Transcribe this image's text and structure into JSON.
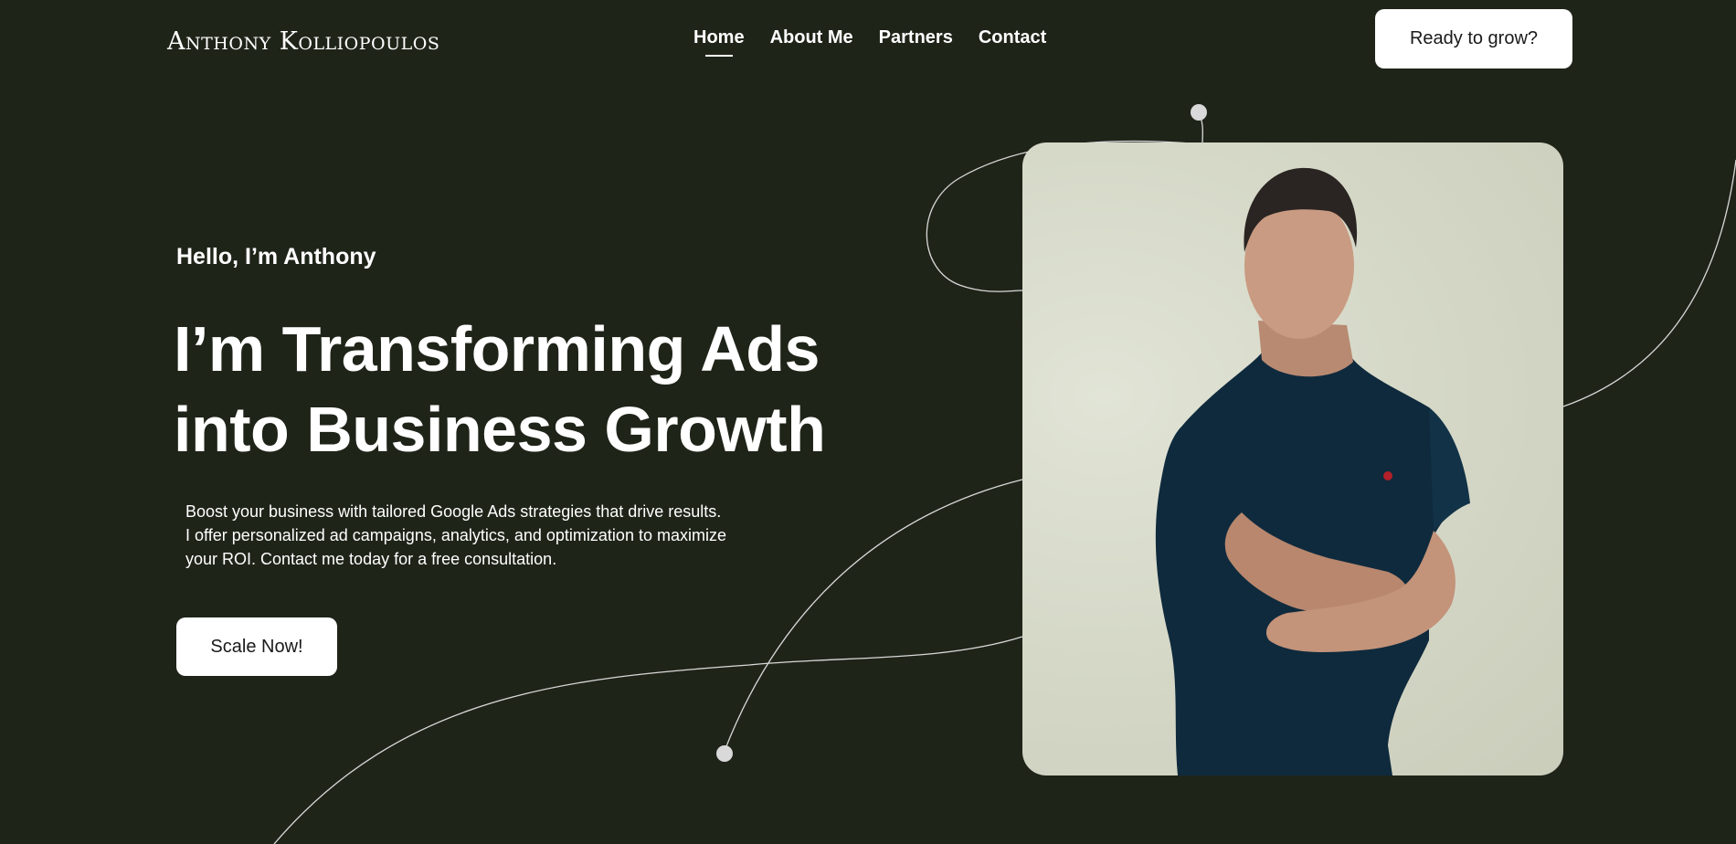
{
  "header": {
    "brand": "Anthony Kolliopoulos",
    "nav": [
      {
        "label": "Home",
        "active": true
      },
      {
        "label": "About Me",
        "active": false
      },
      {
        "label": "Partners",
        "active": false
      },
      {
        "label": "Contact",
        "active": false
      }
    ],
    "cta_label": "Ready to grow?"
  },
  "hero": {
    "greeting": "Hello, I’m Anthony",
    "headline_line1": "I’m Transforming Ads",
    "headline_line2": "into Business Growth",
    "description_line1": "Boost your business with tailored Google Ads strategies that drive results.",
    "description_line2": "I offer personalized ad campaigns, analytics, and optimization to maximize",
    "description_line3": "your ROI. Contact me today for a free consultation.",
    "cta_label": "Scale Now!"
  },
  "colors": {
    "background": "#1f2419",
    "text": "#ffffff",
    "button_bg": "#ffffff",
    "button_text": "#1a1a1a",
    "decor_line": "#d9d9d9"
  }
}
